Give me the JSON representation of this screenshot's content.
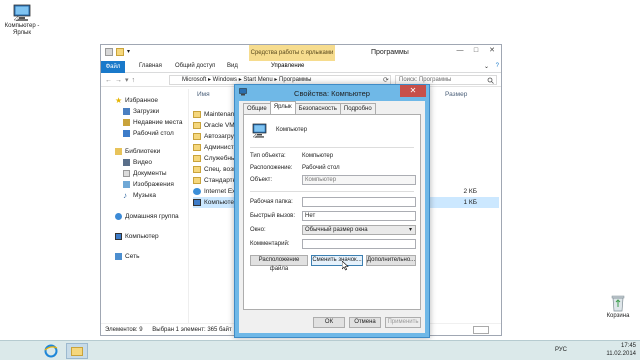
{
  "desktop": {
    "computer_icon_label": "Компьютер - Ярлык",
    "recycle_bin_label": "Корзина"
  },
  "explorer": {
    "context_tab": "Средства работы с ярлыками",
    "window_title": "Программы",
    "ribbon": {
      "file": "Файл",
      "home": "Главная",
      "share": "Общий доступ",
      "view": "Вид",
      "manage": "Управление"
    },
    "address": {
      "path": "Microsoft  ▸ Windows ▸ Start Menu ▸ Программы",
      "search_placeholder": "Поиск: Программы"
    },
    "nav": {
      "favorites": "Избранное",
      "downloads": "Загрузки",
      "recent": "Недавние места",
      "desktop": "Рабочий стол",
      "libraries": "Библиотеки",
      "video": "Видео",
      "docs": "Документы",
      "images": "Изображения",
      "music": "Музыка",
      "homegroup": "Домашняя группа",
      "computer": "Компьютер",
      "network": "Сеть"
    },
    "columns": {
      "name": "Имя",
      "size": "Размер"
    },
    "files": [
      {
        "name": "Maintenanc",
        "size": ""
      },
      {
        "name": "Oracle VM V",
        "size": ""
      },
      {
        "name": "Автозагрузк",
        "size": ""
      },
      {
        "name": "Администр",
        "size": ""
      },
      {
        "name": "Служебные",
        "size": ""
      },
      {
        "name": "Спец. возм",
        "size": ""
      },
      {
        "name": "Стандартн",
        "size": ""
      },
      {
        "name": "Internet Expl",
        "size": "2 КБ"
      },
      {
        "name": "Компьютер",
        "size": "1 КБ"
      }
    ],
    "status": {
      "count": "Элементов: 9",
      "selected": "Выбран 1 элемент: 365 байт"
    }
  },
  "dialog": {
    "title": "Свойства: Компьютер",
    "tabs": [
      "Общие",
      "Ярлык",
      "Безопасность",
      "Подробно"
    ],
    "name": "Компьютер",
    "labels": {
      "type": "Тип объекта:",
      "location": "Расположение:",
      "object": "Объект:",
      "workdir": "Рабочая папка:",
      "hotkey": "Быстрый вызов:",
      "window": "Окно:",
      "comment": "Комментарий:"
    },
    "values": {
      "type": "Компьютер",
      "location": "Рабочий стол",
      "object": "Компьютер",
      "workdir": "",
      "hotkey": "Нет",
      "window": "Обычный размер окна",
      "comment": ""
    },
    "buttons": {
      "open_location": "Расположение файла",
      "change_icon": "Сменить значок...",
      "advanced": "Дополнительно...",
      "ok": "ОК",
      "cancel": "Отмена",
      "apply": "Применить"
    }
  },
  "taskbar": {
    "lang": "РУС",
    "time": "17:45",
    "date": "11.02.2014"
  },
  "colors": {
    "accent": "#1979ca",
    "context_tab": "#f6dc8e",
    "dialog_frame": "#6fb8e7",
    "close": "#c7504a"
  }
}
